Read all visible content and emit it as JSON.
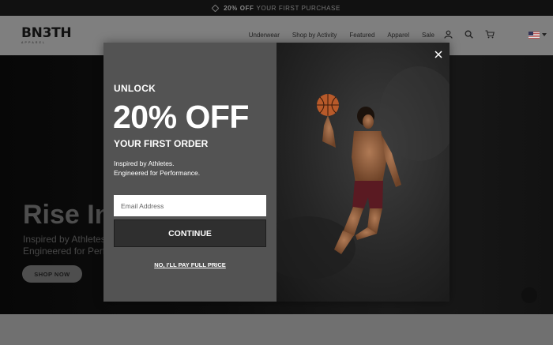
{
  "announcement": {
    "highlight": "20% OFF",
    "text": "YOUR FIRST PURCHASE",
    "icon": "tag-icon"
  },
  "header": {
    "logo": "BN3TH",
    "logo_sub": "APPAREL",
    "nav": [
      "Underwear",
      "Shop by Activity",
      "Featured",
      "Apparel",
      "Sale"
    ],
    "icons": [
      "account-icon",
      "search-icon",
      "cart-icon",
      "us-flag-icon"
    ]
  },
  "hero": {
    "title": "Rise In",
    "subtitle_line1": "Inspired by Athletes.",
    "subtitle_line2": "Engineered for Performance.",
    "cta": "SHOP NOW"
  },
  "popup": {
    "unlock": "UNLOCK",
    "discount": "20% OFF",
    "subheading": "YOUR FIRST ORDER",
    "tagline_line1": "Inspired by Athletes.",
    "tagline_line2": "Engineered for Performance.",
    "email_placeholder": "Email Address",
    "continue_label": "CONTINUE",
    "decline_label": "NO, I'LL PAY FULL PRICE",
    "image": "athlete-dunking-basketball",
    "close_icon": "close-icon"
  },
  "colors": {
    "popup_bg": "#535353",
    "button_bg": "#2f2f2f",
    "header_bg": "#7f7f7f"
  }
}
